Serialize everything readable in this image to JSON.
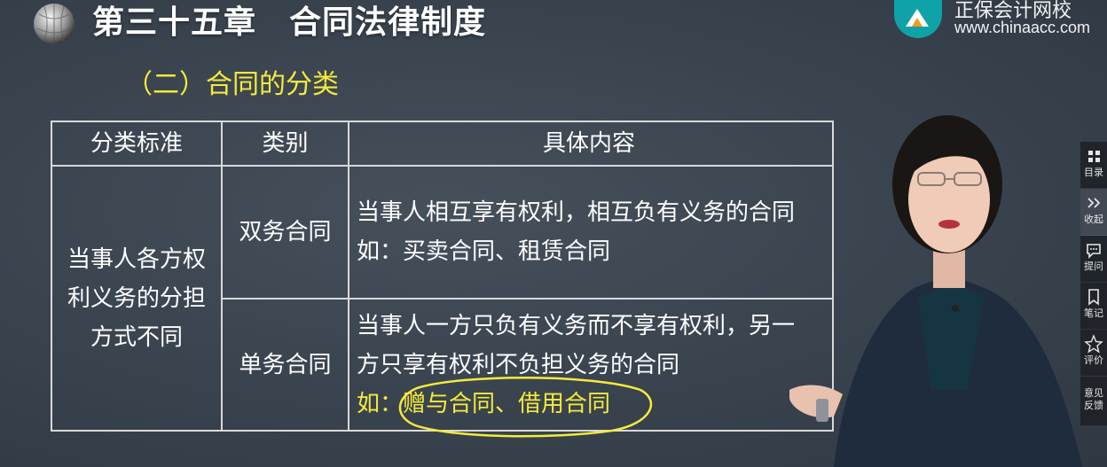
{
  "header": {
    "chapter_title": "第三十五章　合同法律制度",
    "brand_name": "正保会计网校",
    "brand_url": "www.chinaacc.com"
  },
  "section": {
    "title": "（二）合同的分类"
  },
  "table": {
    "headers": [
      "分类标准",
      "类别",
      "具体内容"
    ],
    "criterion": [
      "当事人各方权",
      "利义务的分担",
      "方式不同"
    ],
    "rows": [
      {
        "category": "双务合同",
        "line1": "当事人相互享有权利，相互负有义务的合同",
        "example": "如：买卖合同、租赁合同"
      },
      {
        "category": "单务合同",
        "line1": "当事人一方只负有义务而不享有权利，另一",
        "line2": "方只享有权利不负担义务的合同",
        "example": "如：赠与合同、借用合同"
      }
    ]
  },
  "toolbar": {
    "items": [
      {
        "label": "目录",
        "icon": "grid-icon"
      },
      {
        "label": "收起",
        "icon": "collapse-icon"
      },
      {
        "label": "提问",
        "icon": "question-icon"
      },
      {
        "label": "笔记",
        "icon": "note-icon"
      },
      {
        "label": "评价",
        "icon": "star-icon"
      },
      {
        "label_line1": "意见",
        "label_line2": "反馈"
      }
    ]
  },
  "colors": {
    "background": "#39434e",
    "highlight_yellow": "#f6ea3c",
    "table_border": "#d9d9d9",
    "brand_teal": "#0fa3a8"
  }
}
